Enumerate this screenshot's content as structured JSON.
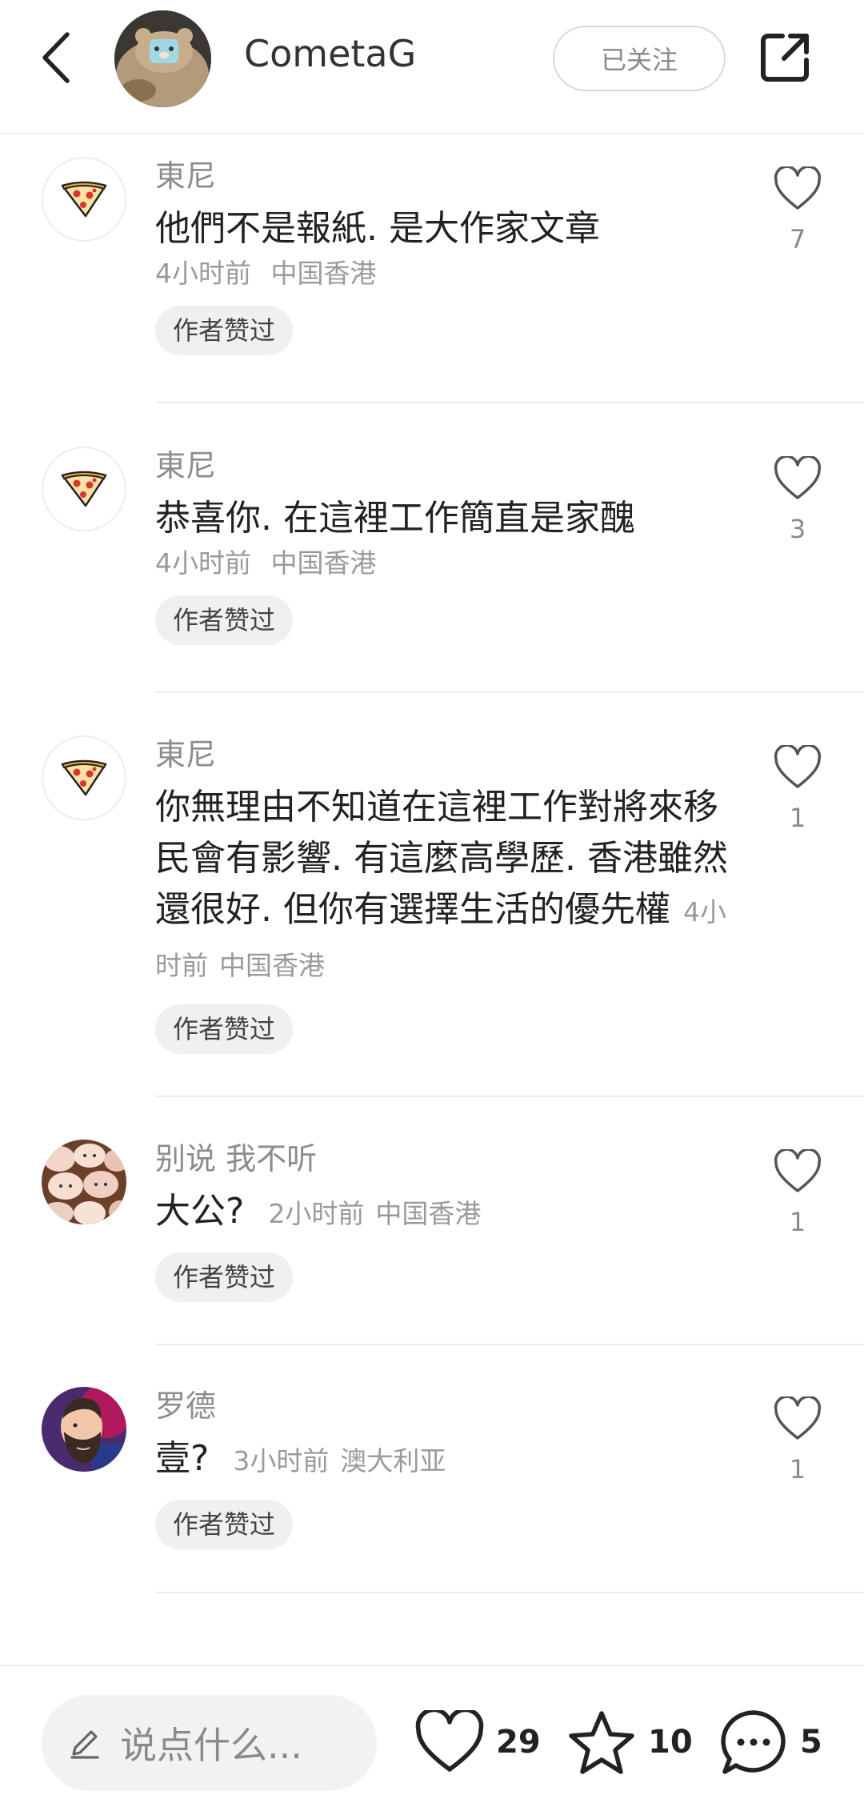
{
  "header": {
    "username": "CometaG",
    "follow_label": "已关注"
  },
  "comments": [
    {
      "name": "東尼",
      "text": "他們不是報紙. 是大作家文章",
      "time": "4小时前",
      "location": "中国香港",
      "badge": "作者赞过",
      "likes": "7",
      "avatar": "pizza-icon"
    },
    {
      "name": "東尼",
      "text": "恭喜你. 在這裡工作簡直是家醜",
      "time": "4小时前",
      "location": "中国香港",
      "badge": "作者赞过",
      "likes": "3",
      "avatar": "pizza-icon"
    },
    {
      "name": "東尼",
      "text": "你無理由不知道在這裡工作對將來移民會有影響. 有這麼高學歷. 香港雖然還很好. 但你有選擇生活的優先權",
      "time": "4小时前",
      "location": "中国香港",
      "badge": "作者赞过",
      "likes": "1",
      "avatar": "pizza-icon"
    },
    {
      "name": "别说 我不听",
      "text": "大公?",
      "time": "2小时前",
      "location": "中国香港",
      "badge": "作者赞过",
      "likes": "1",
      "avatar": "plush-toys-photo"
    },
    {
      "name": "罗德",
      "text": "壹?",
      "time": "3小时前",
      "location": "澳大利亚",
      "badge": "作者赞过",
      "likes": "1",
      "avatar": "bearded-man-illustration"
    }
  ],
  "bottom_bar": {
    "input_placeholder": "说点什么...",
    "likes_count": "29",
    "favorites_count": "10",
    "comments_count": "5"
  },
  "colors": {
    "like_red": "#e53935",
    "pizza_crust": "#e8a33d",
    "pepperoni": "#d9362f"
  }
}
